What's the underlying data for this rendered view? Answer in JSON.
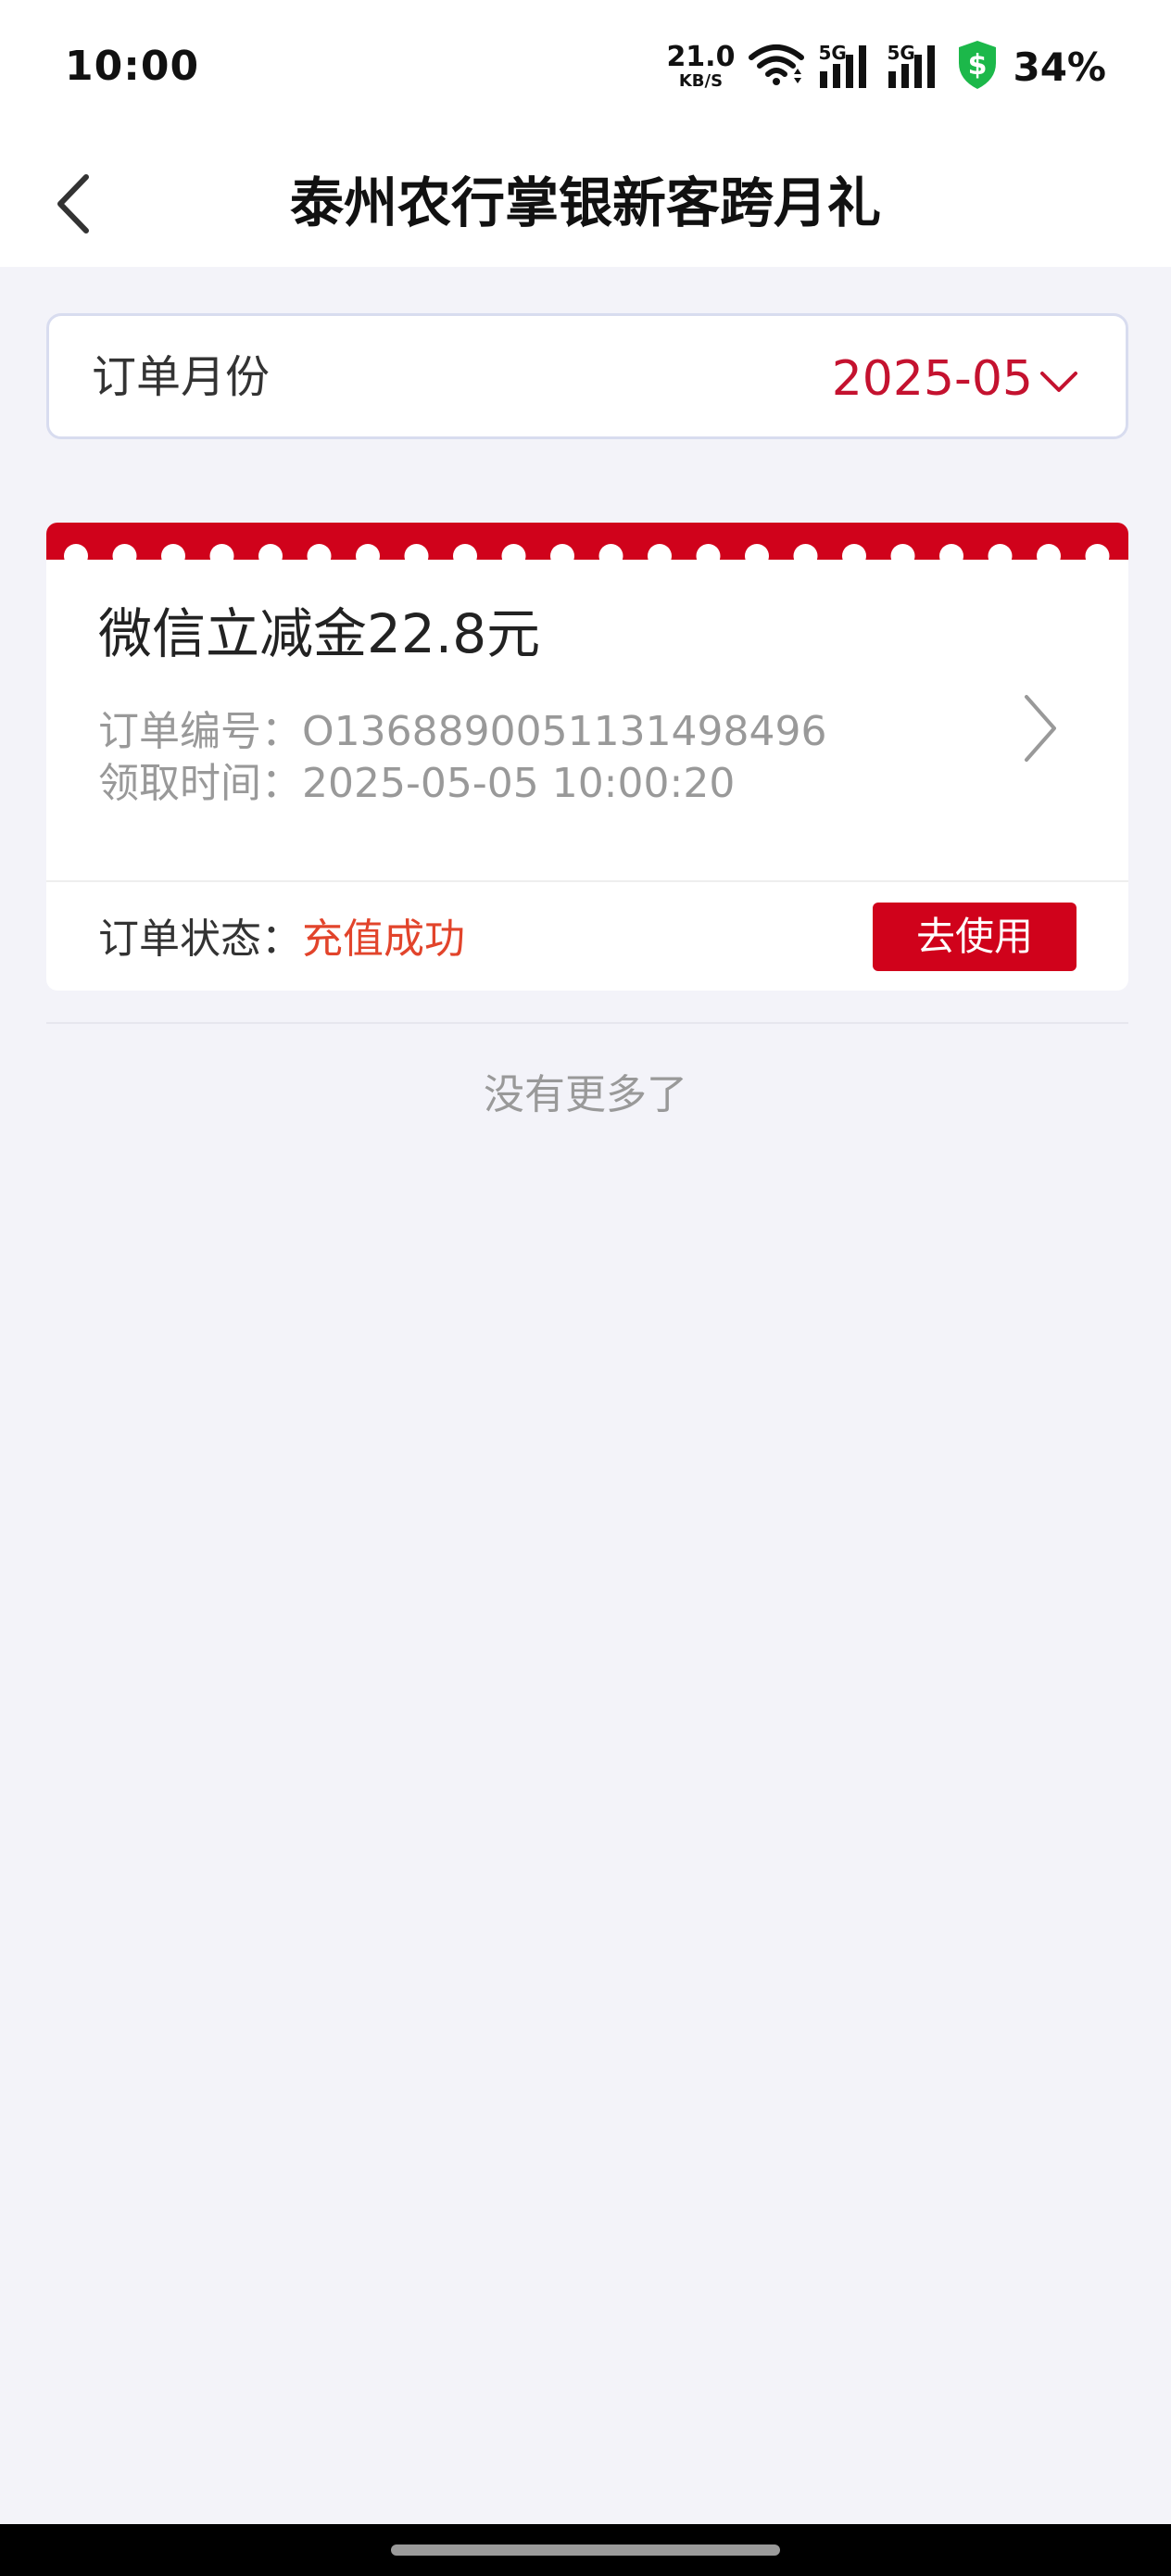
{
  "status_bar": {
    "time": "10:00",
    "net_speed_value": "21.0",
    "net_speed_unit": "KB/S",
    "sim1_tag": "5G",
    "sim2_tag": "5G",
    "battery_percent": "34%",
    "shield_symbol": "$",
    "icons": [
      "wifi-icon",
      "signal-icon",
      "signal-icon",
      "security-shield-icon"
    ]
  },
  "nav": {
    "title": "泰州农行掌银新客跨月礼",
    "back_icon": "chevron-left-icon"
  },
  "month_filter": {
    "label": "订单月份",
    "value": "2025-05",
    "icon": "chevron-down-icon"
  },
  "orders": [
    {
      "title": "微信立减金22.8元",
      "order_no_label": "订单编号：",
      "order_no": "O1368890051131498496",
      "claim_time_label": "领取时间：",
      "claim_time": "2025-05-05 10:00:20",
      "status_label": "订单状态：",
      "status": "充值成功",
      "action_label": "去使用"
    }
  ],
  "list_footer": "没有更多了",
  "colors": {
    "accent_red": "#d0021b",
    "month_red": "#c4122f",
    "status_orange_red": "#e2442b",
    "page_bg": "#f3f3f9"
  }
}
